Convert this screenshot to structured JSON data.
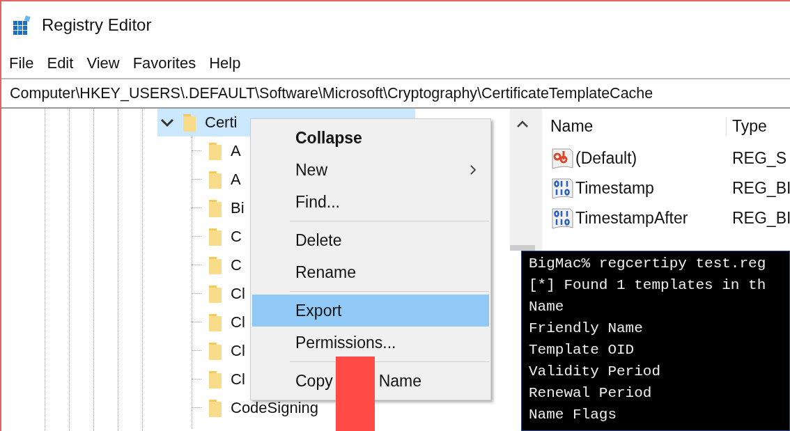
{
  "window": {
    "title": "Registry Editor"
  },
  "menu_bar": [
    "File",
    "Edit",
    "View",
    "Favorites",
    "Help"
  ],
  "address_bar": {
    "path": "Computer\\HKEY_USERS\\.DEFAULT\\Software\\Microsoft\\Cryptography\\CertificateTemplateCache"
  },
  "tree": {
    "label": "Certi",
    "expanded": true,
    "selected": true,
    "children": [
      {
        "label": "A",
        "selected": false
      },
      {
        "label": "A",
        "selected": false
      },
      {
        "label": "Bi",
        "selected": false
      },
      {
        "label": "C",
        "selected": false
      },
      {
        "label": "C",
        "selected": false
      },
      {
        "label": "Cl",
        "selected": false
      },
      {
        "label": "Cl",
        "selected": false
      },
      {
        "label": "Cl",
        "selected": false
      },
      {
        "label": "Cl",
        "selected": false
      },
      {
        "label": "CodeSigning",
        "selected": false
      }
    ]
  },
  "context_menu": {
    "items": [
      {
        "kind": "item",
        "label": "Collapse",
        "default": true,
        "selected": false
      },
      {
        "kind": "submenu",
        "label": "New",
        "default": false,
        "selected": false
      },
      {
        "kind": "item",
        "label": "Find...",
        "default": false,
        "selected": false
      },
      {
        "kind": "separator"
      },
      {
        "kind": "item",
        "label": "Delete",
        "default": false,
        "selected": false
      },
      {
        "kind": "item",
        "label": "Rename",
        "default": false,
        "selected": false
      },
      {
        "kind": "separator"
      },
      {
        "kind": "item",
        "label": "Export",
        "default": false,
        "selected": true
      },
      {
        "kind": "item",
        "label": "Permissions...",
        "default": false,
        "selected": false
      },
      {
        "kind": "separator"
      },
      {
        "kind": "redacted",
        "label": "Copy",
        "label_after": "Name",
        "default": false,
        "selected": false
      }
    ]
  },
  "values": {
    "columns": [
      "Name",
      "Type"
    ],
    "rows": [
      {
        "kind": "string",
        "name": "(Default)",
        "type": "REG_S"
      },
      {
        "kind": "binary",
        "name": "Timestamp",
        "type": "REG_BI"
      },
      {
        "kind": "binary",
        "name": "TimestampAfter",
        "type": "REG_BI"
      }
    ]
  },
  "terminal": {
    "lines": [
      "BigMac% regcertipy test.reg",
      "[*] Found 1 templates in th",
      "Name",
      "Friendly Name",
      "Template OID",
      "Validity Period",
      "Renewal Period",
      "Name Flags"
    ]
  }
}
